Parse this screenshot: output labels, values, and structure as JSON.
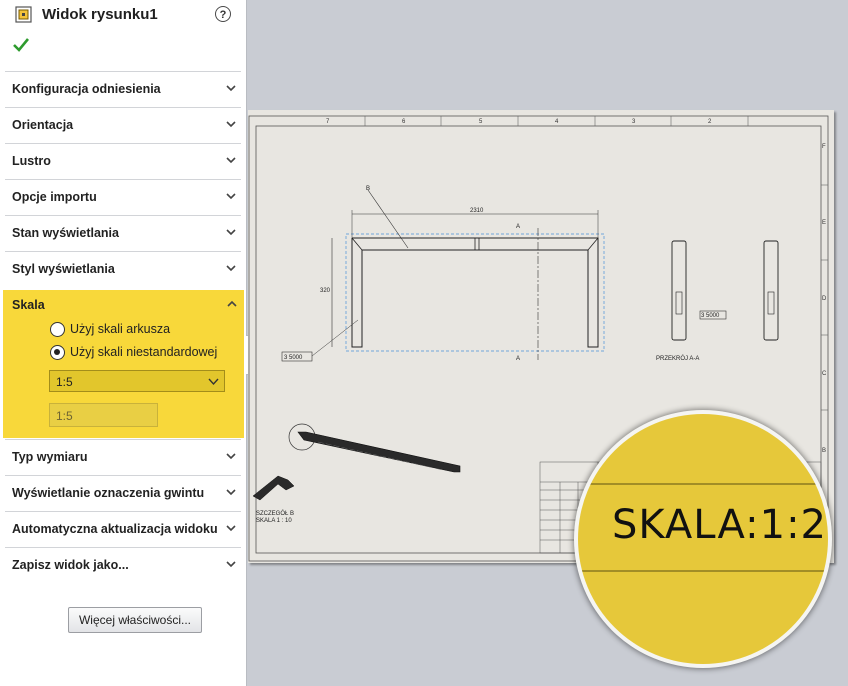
{
  "panel": {
    "title": "Widok rysunku1",
    "help_icon": "?"
  },
  "sections": {
    "s0": "Konfiguracja odniesienia",
    "s1": "Orientacja",
    "s2": "Lustro",
    "s3": "Opcje importu",
    "s4": "Stan wyświetlania",
    "s5": "Styl wyświetlania",
    "s6": "Typ wymiaru",
    "s7": "Wyświetlanie oznaczenia gwintu",
    "s8": "Automatyczna aktualizacja widoku",
    "s9": "Zapisz widok jako..."
  },
  "skala": {
    "title": "Skala",
    "option_sheet": "Użyj skali arkusza",
    "option_custom": "Użyj skali niestandardowej",
    "selected_option": "custom",
    "select_value": "1:5",
    "input_value": "1:5"
  },
  "more_button": "Więcej właściwości...",
  "drawing": {
    "zone_top": [
      "7",
      "6",
      "5",
      "4",
      "3",
      "2"
    ],
    "zone_right": [
      "F",
      "E",
      "D",
      "C",
      "B"
    ],
    "dim_width": "2310",
    "dim_height": "320",
    "label_B": "B",
    "section_A": "A",
    "note_left": "3 5000",
    "note_right": "3 5000",
    "section_view_label": "PRZEKRÓJ A-A",
    "detail_label_1": "SZCZEGÓŁ B",
    "detail_label_2": "SKALA 1 : 10"
  },
  "magnifier": {
    "text": "SKALA:1:2"
  },
  "colors": {
    "highlight": "#f8d83a",
    "magnifier_fill": "#e6c83a",
    "check": "#2e9b2e"
  },
  "icons": {
    "panel": "drawing-view-icon",
    "help": "help-icon",
    "ok": "check-icon",
    "expand": "chevron-down-icon",
    "collapse": "chevron-up-icon"
  }
}
